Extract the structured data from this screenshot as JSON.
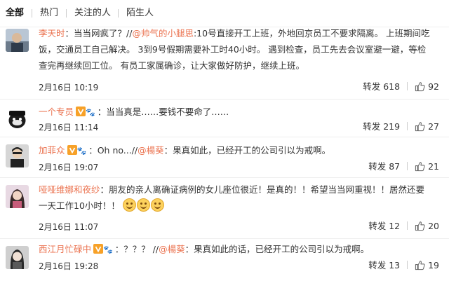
{
  "tabs": [
    "全部",
    "热门",
    "关注的人",
    "陌生人"
  ],
  "comments": [
    {
      "username": "李天时",
      "body_before": "：当当网疯了？//",
      "mention": "@帅气的小腿思",
      "body_after": ":10号直接开工上班，外地回京员工不要求隔离。 上班期间吃饭，交通员工自己解决。 3到9号假期需要补工时40小时。 遇到检查，员工先去会议室避一避，等检查完再继续回工位。 有员工家属确诊，让大家做好防护，继续上班。",
      "time": "2月16日 10:19",
      "repost_label": "转发",
      "repost_count": "618",
      "like_count": "92"
    },
    {
      "username": "一个专员",
      "body_before": "：当当真是……要钱不要命了……",
      "mention": "",
      "body_after": "",
      "time": "2月16日 11:14",
      "repost_label": "转发",
      "repost_count": "219",
      "like_count": "27"
    },
    {
      "username": "加菲众",
      "body_before": "：Oh no...//",
      "mention": "@楊葵",
      "body_after": "：果真如此，已经开工的公司引以为戒啊。",
      "time": "2月16日 19:07",
      "repost_label": "转发",
      "repost_count": "87",
      "like_count": "21"
    },
    {
      "username": "哑哑维娜和夜纱",
      "body_before": "：朋友的亲人离确证病例的女儿座位很近！是真的！！希望当当网重视！！居然还要一天工作10小时！！",
      "mention": "",
      "body_after": "",
      "time": "2月16日 11:07",
      "repost_label": "转发",
      "repost_count": "12",
      "like_count": "20"
    },
    {
      "username": "西江月忙碌中",
      "body_before": "：？？？ //",
      "mention": "@楊葵",
      "body_after": "：果真如此的话，已经开工的公司引以为戒啊。",
      "time": "2月16日 19:28",
      "repost_label": "转发",
      "repost_count": "13",
      "like_count": "19"
    }
  ]
}
